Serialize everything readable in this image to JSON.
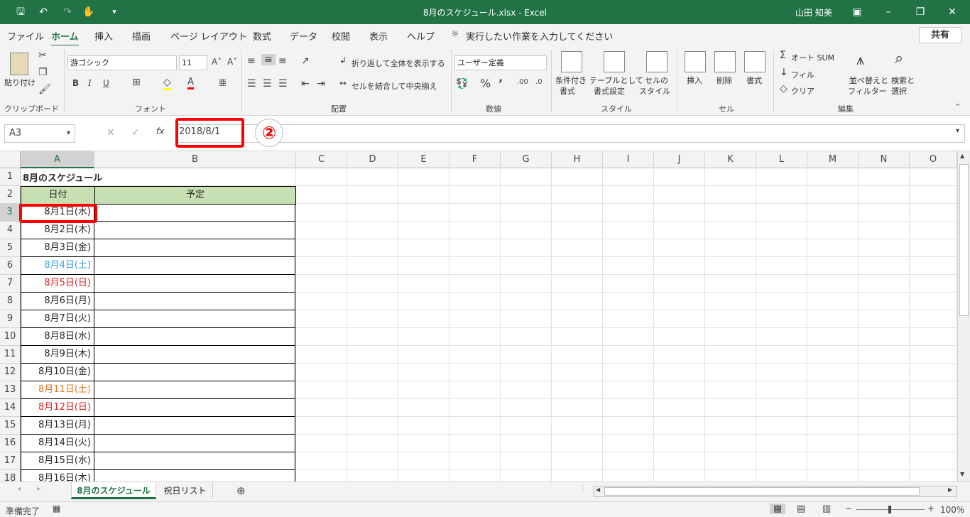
{
  "window": {
    "title": "8月のスケジュール.xlsx - Excel",
    "user": "山田 知美"
  },
  "menu": {
    "tabs": [
      "ファイル",
      "ホーム",
      "挿入",
      "描画",
      "ページ レイアウト",
      "数式",
      "データ",
      "校閲",
      "表示",
      "ヘルプ"
    ],
    "active_tab": "ホーム",
    "tell_me": "実行したい作業を入力してください",
    "share": "共有"
  },
  "ribbon": {
    "clipboard": {
      "paste": "貼り付け",
      "label": "クリップボード"
    },
    "font": {
      "name": "游ゴシック",
      "size": "11",
      "bold": "B",
      "italic": "I",
      "underline": "U",
      "label": "フォント"
    },
    "alignment": {
      "wrap": "折り返して全体を表示する",
      "merge": "セルを結合して中央揃え",
      "label": "配置"
    },
    "number": {
      "format": "ユーザー定義",
      "label": "数値"
    },
    "styles": {
      "conditional": [
        "条件付き",
        "書式"
      ],
      "table": [
        "テーブルとして",
        "書式設定"
      ],
      "cell": [
        "セルの",
        "スタイル"
      ],
      "label": "スタイル"
    },
    "cells": {
      "insert": "挿入",
      "delete": "削除",
      "format": "書式",
      "label": "セル"
    },
    "editing": {
      "autosum": "オート SUM",
      "fill": "フィル",
      "clear": "クリア",
      "sort": [
        "並べ替えと",
        "フィルター"
      ],
      "find": [
        "検索と",
        "選択"
      ],
      "label": "編集"
    }
  },
  "formula_bar": {
    "name_box": "A3",
    "fx": "fx",
    "value": "2018/8/1",
    "step": "②"
  },
  "sheet": {
    "columns": [
      "A",
      "B",
      "C",
      "D",
      "E",
      "F",
      "G",
      "H",
      "I",
      "J",
      "K",
      "L",
      "M",
      "N",
      "O"
    ],
    "title": "8月のスケジュール",
    "header_date": "日付",
    "header_plan": "予定",
    "dates": [
      {
        "text": "8月1日(水)",
        "color": "#262626"
      },
      {
        "text": "8月2日(木)",
        "color": "#262626"
      },
      {
        "text": "8月3日(金)",
        "color": "#262626"
      },
      {
        "text": "8月4日(土)",
        "color": "#2e9fd8"
      },
      {
        "text": "8月5日(日)",
        "color": "#e02020"
      },
      {
        "text": "8月6日(月)",
        "color": "#262626"
      },
      {
        "text": "8月7日(火)",
        "color": "#262626"
      },
      {
        "text": "8月8日(水)",
        "color": "#262626"
      },
      {
        "text": "8月9日(木)",
        "color": "#262626"
      },
      {
        "text": "8月10日(金)",
        "color": "#262626"
      },
      {
        "text": "8月11日(土)",
        "color": "#e07b22"
      },
      {
        "text": "8月12日(日)",
        "color": "#e02020"
      },
      {
        "text": "8月13日(月)",
        "color": "#262626"
      },
      {
        "text": "8月14日(火)",
        "color": "#262626"
      },
      {
        "text": "8月15日(水)",
        "color": "#262626"
      },
      {
        "text": "8月16日(木)",
        "color": "#262626"
      }
    ],
    "header_fill": "#c6e0b4"
  },
  "sheet_tabs": [
    "8月のスケジュール",
    "祝日リスト"
  ],
  "status": {
    "text": "準備完了",
    "zoom": "100%"
  }
}
